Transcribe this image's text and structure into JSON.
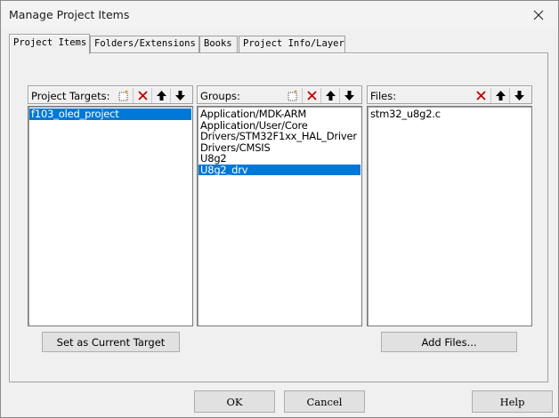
{
  "window": {
    "title": "Manage Project Items"
  },
  "tabs": [
    {
      "label": "Project Items",
      "active": true
    },
    {
      "label": "Folders/Extensions",
      "active": false
    },
    {
      "label": "Books",
      "active": false
    },
    {
      "label": "Project Info/Layer",
      "active": false
    }
  ],
  "targets": {
    "label": "Project Targets:",
    "items": [
      "f103_oled_project"
    ],
    "selected_index": 0
  },
  "groups": {
    "label": "Groups:",
    "items": [
      "Application/MDK-ARM",
      "Application/User/Core",
      "Drivers/STM32F1xx_HAL_Driver",
      "Drivers/CMSIS",
      "U8g2",
      "U8g2_drv"
    ],
    "selected_index": 5
  },
  "files": {
    "label": "Files:",
    "items": [
      "stm32_u8g2.c"
    ]
  },
  "buttons": {
    "set_current_target": "Set as Current Target",
    "add_files": "Add Files...",
    "ok": "OK",
    "cancel": "Cancel",
    "help": "Help"
  },
  "icons": [
    "new-icon",
    "delete-icon",
    "move-up-icon",
    "move-down-icon",
    "close-icon"
  ],
  "colors": {
    "selection": "#0078d7",
    "delete_red": "#c00000"
  }
}
